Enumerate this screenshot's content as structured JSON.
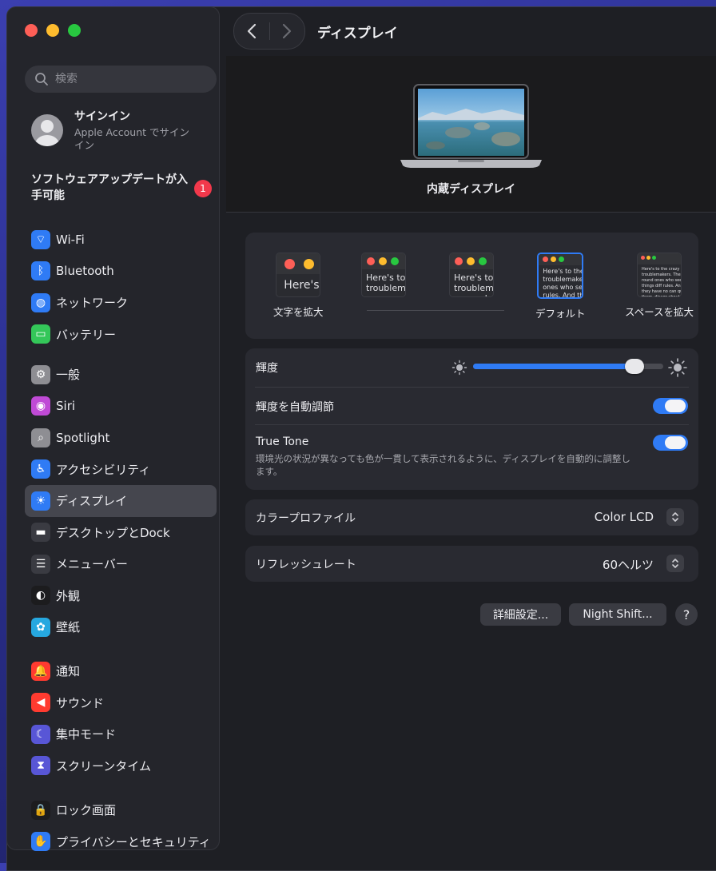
{
  "window": {
    "title": "ディスプレイ"
  },
  "sidebar": {
    "search_placeholder": "検索",
    "account": {
      "title": "サインイン",
      "subtitle": "Apple Account でサインイン"
    },
    "update": {
      "label": "ソフトウェアアップデートが入手可能",
      "badge": "1"
    },
    "groups": [
      [
        {
          "label": "Wi-Fi",
          "icon": "wifi-icon",
          "color": "#2f7bf5"
        },
        {
          "label": "Bluetooth",
          "icon": "bluetooth-icon",
          "color": "#2f7bf5"
        },
        {
          "label": "ネットワーク",
          "icon": "globe-icon",
          "color": "#2f7bf5"
        },
        {
          "label": "バッテリー",
          "icon": "battery-icon",
          "color": "#34c759"
        }
      ],
      [
        {
          "label": "一般",
          "icon": "gear-icon",
          "color": "#8e8e93"
        },
        {
          "label": "Siri",
          "icon": "siri-icon",
          "color": "#c04ad6"
        },
        {
          "label": "Spotlight",
          "icon": "magnifier-icon",
          "color": "#8e8e93"
        },
        {
          "label": "アクセシビリティ",
          "icon": "accessibility-icon",
          "color": "#2f7bf5"
        },
        {
          "label": "ディスプレイ",
          "icon": "sun-icon",
          "color": "#2f7bf5",
          "active": true
        },
        {
          "label": "デスクトップとDock",
          "icon": "dock-icon",
          "color": "#3a3b42"
        },
        {
          "label": "メニューバー",
          "icon": "menubar-icon",
          "color": "#3a3b42"
        },
        {
          "label": "外観",
          "icon": "appearance-icon",
          "color": "#1c1c1e"
        },
        {
          "label": "壁紙",
          "icon": "wallpaper-icon",
          "color": "#26a8e0"
        }
      ],
      [
        {
          "label": "通知",
          "icon": "bell-icon",
          "color": "#ff3b30"
        },
        {
          "label": "サウンド",
          "icon": "speaker-icon",
          "color": "#ff3b30"
        },
        {
          "label": "集中モード",
          "icon": "moon-icon",
          "color": "#5856d6"
        },
        {
          "label": "スクリーンタイム",
          "icon": "hourglass-icon",
          "color": "#5856d6"
        }
      ],
      [
        {
          "label": "ロック画面",
          "icon": "lock-icon",
          "color": "#1c1c1e"
        },
        {
          "label": "プライバシーとセキュリティ",
          "icon": "hand-icon",
          "color": "#2f7bf5"
        }
      ]
    ]
  },
  "display": {
    "name": "内蔵ディスプレイ",
    "resolutions": [
      {
        "label": "文字を拡大",
        "preview": "Here's"
      },
      {
        "label": "",
        "preview": "Here's to troublem"
      },
      {
        "label": "",
        "preview": "Here's to t troublema ones who"
      },
      {
        "label": "デフォルト",
        "preview": "Here's to the c troublemakers. ones who see t rules. And they",
        "selected": true
      },
      {
        "label": "スペースを拡大",
        "preview": "Here's to the crazy ones troublemakers. The round ones who see things diff rules. And they have no can quote them, disagr about the only thing y Because they change th"
      }
    ],
    "brightness": {
      "label": "輝度",
      "value": 0.85
    },
    "auto_brightness": {
      "label": "輝度を自動調節",
      "on": true
    },
    "true_tone": {
      "label": "True Tone",
      "description": "環境光の状況が異なっても色が一貫して表示されるように、ディスプレイを自動的に調整します。",
      "on": true
    },
    "color_profile": {
      "label": "カラープロファイル",
      "value": "Color LCD"
    },
    "refresh_rate": {
      "label": "リフレッシュレート",
      "value": "60ヘルツ"
    },
    "buttons": {
      "advanced": "詳細設定...",
      "night_shift": "Night Shift...",
      "help": "?"
    }
  },
  "colors": {
    "accent": "#2f7bf5",
    "badge": "#f2384b"
  }
}
